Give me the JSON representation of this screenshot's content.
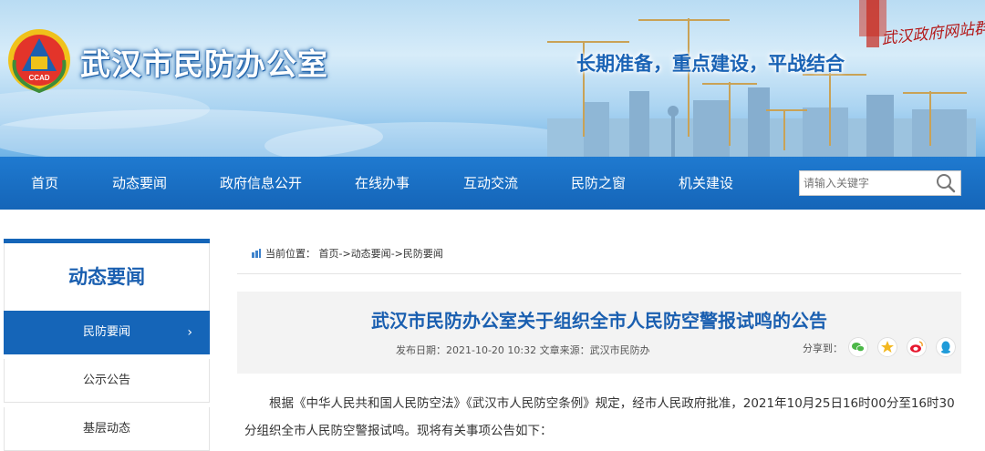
{
  "header": {
    "site_title": "武汉市民防办公室",
    "slogan": "长期准备，重点建设，平战结合",
    "watermark": "武汉政府网站群",
    "logo_text": "CCAD"
  },
  "nav": {
    "items": [
      {
        "label": "首页"
      },
      {
        "label": "动态要闻"
      },
      {
        "label": "政府信息公开"
      },
      {
        "label": "在线办事"
      },
      {
        "label": "互动交流"
      },
      {
        "label": "民防之窗"
      },
      {
        "label": "机关建设"
      }
    ],
    "search": {
      "placeholder": "请输入关键字",
      "icon": "search-icon"
    }
  },
  "sidebar": {
    "title": "动态要闻",
    "items": [
      {
        "label": "民防要闻",
        "active": true
      },
      {
        "label": "公示公告",
        "active": false
      },
      {
        "label": "基层动态",
        "active": false
      }
    ],
    "arrow": "›"
  },
  "breadcrumb": {
    "prefix": "当前位置：",
    "home": "首页",
    "sep1": "->",
    "level1": "动态要闻",
    "sep2": "->",
    "level2": "民防要闻"
  },
  "article": {
    "title": "武汉市民防办公室关于组织全市人民防空警报试鸣的公告",
    "date_label": "发布日期：",
    "date": "2021-10-20 10:32",
    "source_label": "文章来源：",
    "source": "武汉市民防办",
    "share_label": "分享到：",
    "share_icons": [
      "wechat-icon",
      "qzone-icon",
      "weibo-icon",
      "qq-icon"
    ],
    "body": "根据《中华人民共和国人民防空法》《武汉市人民防空条例》规定，经市人民政府批准，2021年10月25日16时00分至16时30分组织全市人民防空警报试鸣。现将有关事项公告如下："
  },
  "colors": {
    "primary": "#1565b8",
    "title_blue": "#1a5fb0",
    "banner_sky": "#b9dcf3"
  }
}
